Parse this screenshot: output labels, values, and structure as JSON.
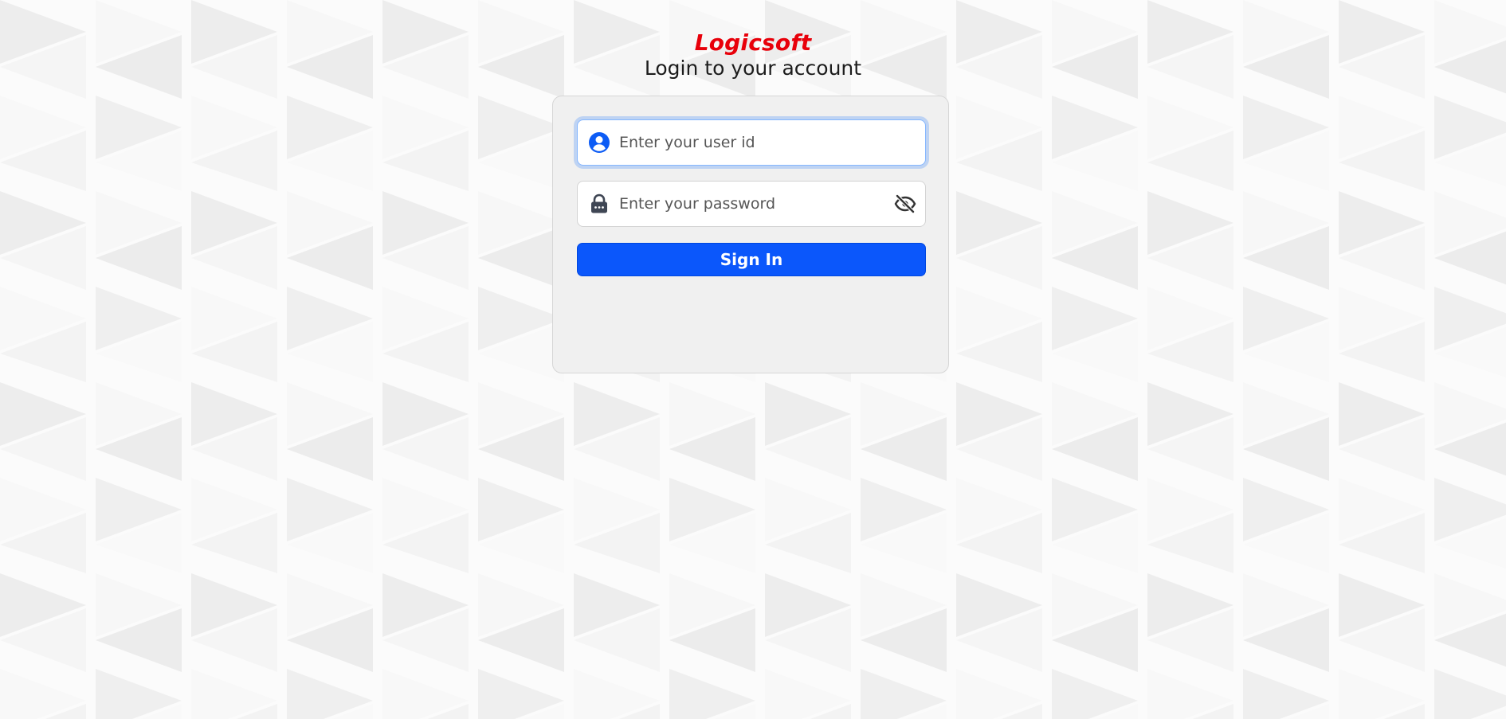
{
  "app": {
    "brand": "Logicsoft",
    "subtitle": "Login to your account"
  },
  "colors": {
    "brand": "#e8000a",
    "primary": "#0b57fb",
    "user_icon": "#0d5cf5",
    "lock_icon": "#3f4654",
    "card_bg": "#f0f0f0"
  },
  "form": {
    "userid": {
      "placeholder": "Enter your user id",
      "value": "",
      "icon": "user-circle-icon"
    },
    "password": {
      "placeholder": "Enter your password",
      "value": "",
      "icon": "lock-icon",
      "toggle_icon": "eye-slash-icon"
    },
    "submit_label": "Sign In"
  }
}
